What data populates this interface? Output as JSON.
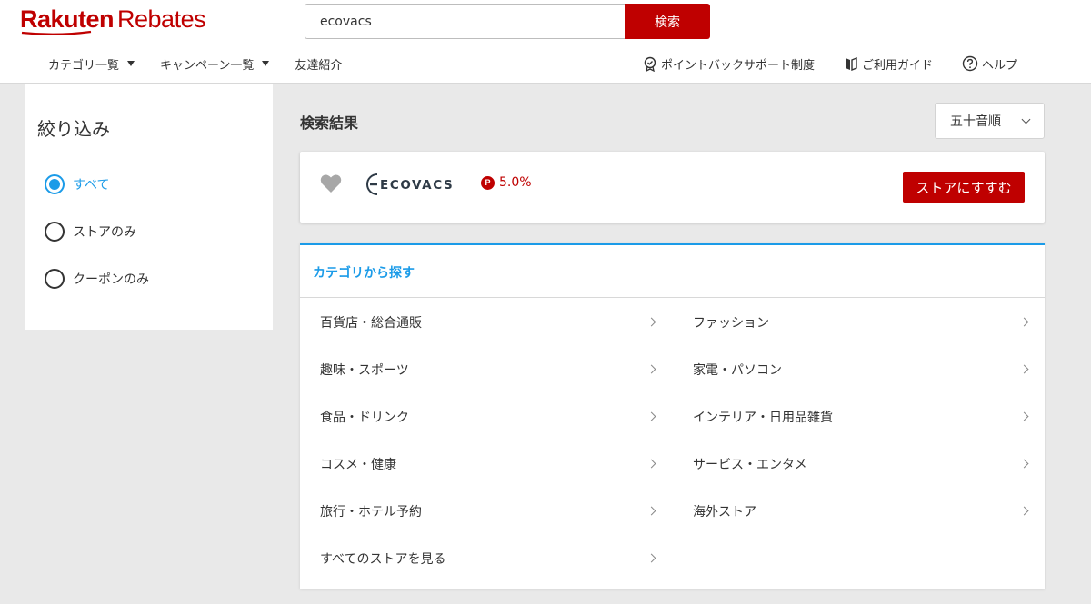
{
  "header": {
    "logo_brand": "Rakuten",
    "logo_product": "Rebates",
    "search_value": "ecovacs",
    "search_button": "検索",
    "nav_left": [
      {
        "label": "カテゴリ一覧"
      },
      {
        "label": "キャンペーン一覧"
      },
      {
        "label": "友達紹介"
      }
    ],
    "nav_right": [
      {
        "label": "ポイントバックサポート制度",
        "icon": "badge-icon"
      },
      {
        "label": "ご利用ガイド",
        "icon": "book-icon"
      },
      {
        "label": "ヘルプ",
        "icon": "help-icon"
      }
    ]
  },
  "sidebar": {
    "title": "絞り込み",
    "options": [
      {
        "label": "すべて",
        "selected": true
      },
      {
        "label": "ストアのみ",
        "selected": false
      },
      {
        "label": "クーポンのみ",
        "selected": false
      }
    ]
  },
  "results": {
    "title": "検索結果",
    "sort_value": "五十音順",
    "store": {
      "logo_text": "ECOVACS",
      "rate": "5.0%",
      "button": "ストアにすすむ"
    }
  },
  "categories": {
    "title": "カテゴリから探す",
    "left": [
      "百貨店・総合通販",
      "趣味・スポーツ",
      "食品・ドリンク",
      "コスメ・健康",
      "旅行・ホテル予約",
      "すべてのストアを見る"
    ],
    "right": [
      "ファッション",
      "家電・パソコン",
      "インテリア・日用品雑貨",
      "サービス・エンタメ",
      "海外ストア"
    ]
  },
  "colors": {
    "brand_red": "#bf0000",
    "accent_blue": "#1b9be8"
  }
}
